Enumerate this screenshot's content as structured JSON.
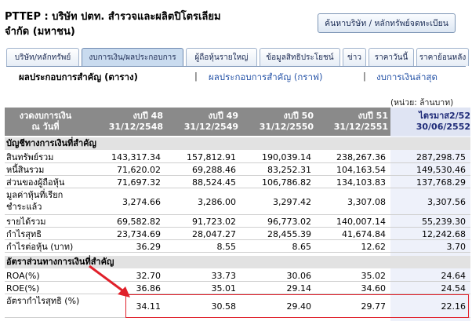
{
  "company": {
    "line1": "PTTEP : บริษัท ปตท. สำรวจและผลิตปิโตรเลียม",
    "line2": "จำกัด (มหาชน)"
  },
  "search_button": "ค้นหาบริษัท / หลักทรัพย์จดทะเบียน",
  "tabs": [
    {
      "label": "บริษัท/หลักทรัพย์",
      "active": false
    },
    {
      "label": "งบการเงิน/ผลประกอบการ",
      "active": true
    },
    {
      "label": "ผู้ถือหุ้นรายใหญ่",
      "active": false
    },
    {
      "label": "ข้อมูลสิทธิประโยชน์",
      "active": false
    },
    {
      "label": "ข่าว",
      "active": false
    },
    {
      "label": "ราคาวันนี้",
      "active": false
    },
    {
      "label": "ราคาย้อนหลัง",
      "active": false
    }
  ],
  "sublinks": {
    "active": "ผลประกอบการสำคัญ (ตาราง)",
    "graph": "ผลประกอบการสำคัญ (กราฟ)",
    "latest": "งบการเงินล่าสุด",
    "separator": "|"
  },
  "unit": "(หน่วย: ล้านบาท)",
  "table": {
    "header_first": [
      "งวดงบการเงิน",
      "ณ วันที่"
    ],
    "columns": [
      [
        "งบปี 48",
        "31/12/2548"
      ],
      [
        "งบปี 49",
        "31/12/2549"
      ],
      [
        "งบปี 50",
        "31/12/2550"
      ],
      [
        "งบปี 51",
        "31/12/2551"
      ],
      [
        "ไตรมาส2/52",
        "30/06/2552"
      ]
    ],
    "section1": "บัญชีทางการเงินที่สำคัญ",
    "rows1": [
      {
        "label": "สินทรัพย์รวม",
        "values": [
          "143,317.34",
          "157,812.91",
          "190,039.14",
          "238,267.36",
          "287,298.75"
        ]
      },
      {
        "label": "หนี้สินรวม",
        "values": [
          "71,620.02",
          "69,288.46",
          "83,252.31",
          "104,163.54",
          "149,530.46"
        ]
      },
      {
        "label": "ส่วนของผู้ถือหุ้น",
        "values": [
          "71,697.32",
          "88,524.45",
          "106,786.82",
          "134,103.83",
          "137,768.29"
        ]
      },
      {
        "label": "มูลค่าหุ้นที่เรียก ชำระแล้ว",
        "values": [
          "3,274.66",
          "3,286.00",
          "3,297.42",
          "3,307.08",
          "3,307.56"
        ]
      },
      {
        "label": "รายได้รวม",
        "values": [
          "69,582.82",
          "91,723.02",
          "96,773.02",
          "140,007.14",
          "55,239.30"
        ]
      },
      {
        "label": "กำไรสุทธิ",
        "values": [
          "23,734.69",
          "28,047.27",
          "28,455.39",
          "41,674.84",
          "12,242.68"
        ]
      },
      {
        "label": "กำไรต่อหุ้น (บาท)",
        "values": [
          "36.29",
          "8.55",
          "8.65",
          "12.62",
          "3.70"
        ]
      }
    ],
    "section2": "อัตราส่วนทางการเงินที่สำคัญ",
    "rows2": [
      {
        "label": "ROA(%)",
        "values": [
          "32.70",
          "33.73",
          "30.06",
          "35.02",
          "24.64"
        ]
      },
      {
        "label": "ROE(%)",
        "values": [
          "36.86",
          "35.01",
          "29.14",
          "34.60",
          "24.54"
        ]
      },
      {
        "label": "อัตรากำไรสุทธิ (%)",
        "values": [
          "34.11",
          "30.58",
          "29.40",
          "29.77",
          "22.16"
        ]
      }
    ]
  },
  "colors": {
    "header_bg": "#8a8a8a",
    "highlight": "#e0202a",
    "link": "#2855a8"
  }
}
